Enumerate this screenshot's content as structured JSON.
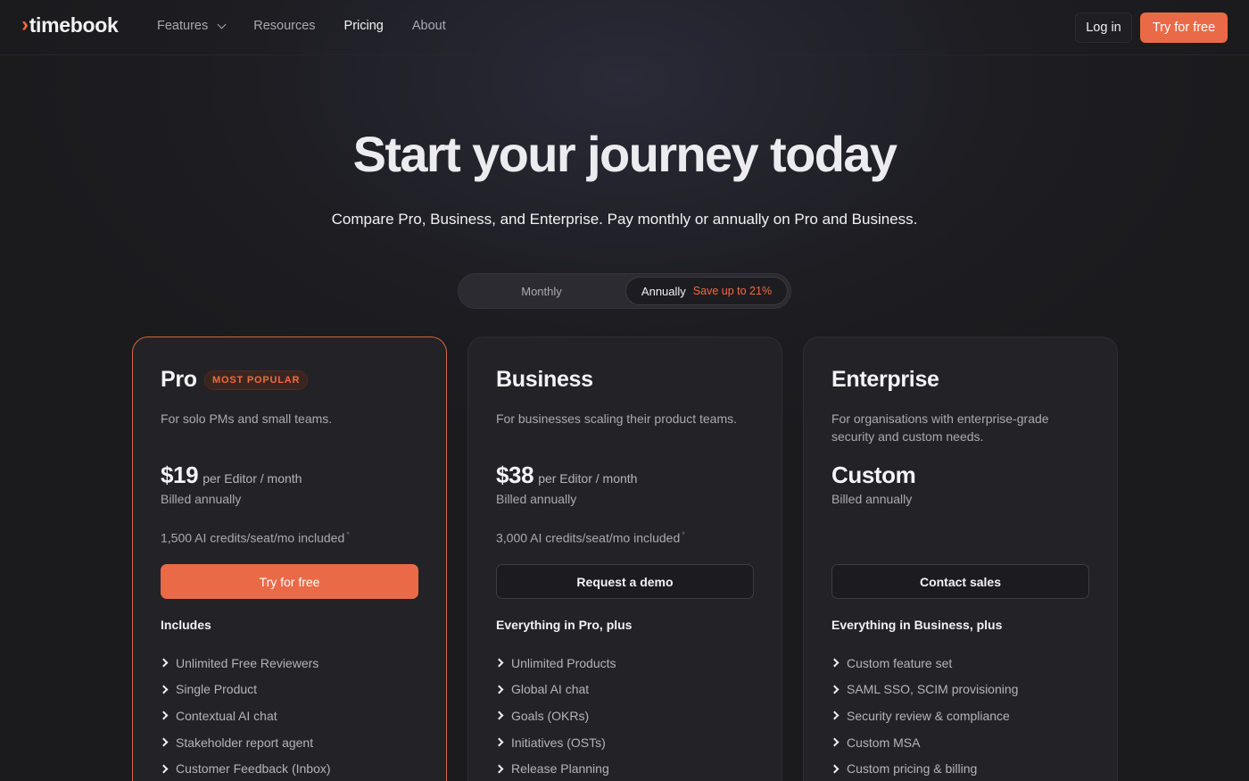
{
  "nav": {
    "logo_mark": "›",
    "logo_text": "timebook",
    "links": [
      {
        "label": "Features"
      },
      {
        "label": "Resources"
      },
      {
        "label": "Pricing"
      },
      {
        "label": "About"
      }
    ],
    "login_label": "Log in",
    "try_label": "Try for free"
  },
  "hero": {
    "title": "Start your journey today",
    "subtitle": "Compare Pro, Business, and Enterprise. Pay monthly or annually on Pro and Business."
  },
  "billing_toggle": {
    "monthly_label": "Monthly",
    "annual_label": "Annually",
    "save_label": "Save up to 21%",
    "selected": "Annually"
  },
  "plans": [
    {
      "name": "Pro",
      "badge": "MOST POPULAR",
      "description": "For solo PMs and small teams.",
      "price": "$19",
      "price_unit": "per Editor / month",
      "billed": "Billed annually",
      "credits": "1,500 AI credits/seat/mo included",
      "credits_mark": "*",
      "cta": "Try for free",
      "includes_heading": "Includes",
      "features": [
        "Unlimited Free Reviewers",
        "Single Product",
        "Contextual AI chat",
        "Stakeholder report agent",
        "Customer Feedback (Inbox)"
      ]
    },
    {
      "name": "Business",
      "description": "For businesses scaling their product teams.",
      "price": "$38",
      "price_unit": "per Editor / month",
      "billed": "Billed annually",
      "credits": "3,000 AI credits/seat/mo included",
      "credits_mark": "*",
      "cta": "Request a demo",
      "includes_heading": "Everything in Pro, plus",
      "features": [
        "Unlimited Products",
        "Global AI chat",
        "Goals (OKRs)",
        "Initiatives (OSTs)",
        "Release Planning"
      ]
    },
    {
      "name": "Enterprise",
      "description": "For organisations with enterprise-grade security and custom needs.",
      "price": "Custom",
      "billed": "Billed annually",
      "cta": "Contact sales",
      "includes_heading": "Everything in Business, plus",
      "features": [
        "Custom feature set",
        "SAML SSO, SCIM provisioning",
        "Security review & compliance",
        "Custom MSA",
        "Custom pricing & billing"
      ]
    }
  ],
  "colors": {
    "accent": "#ea6a47",
    "background": "#1b1b1e",
    "card": "#232327"
  }
}
